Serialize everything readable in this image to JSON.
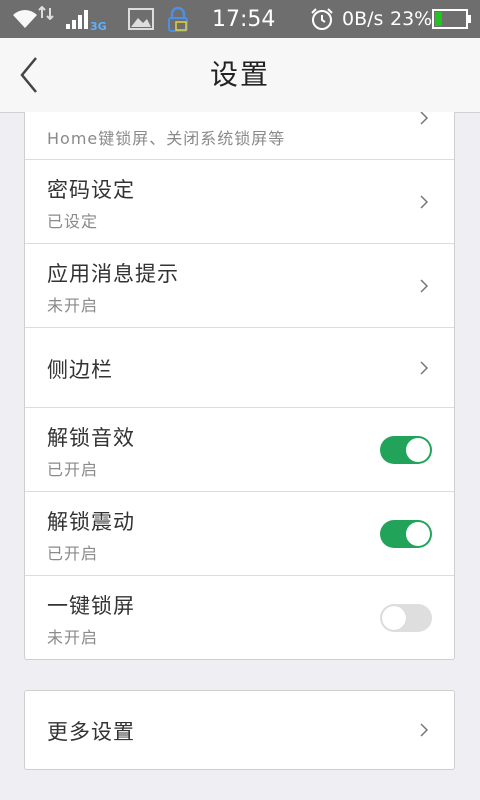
{
  "status_bar": {
    "network_type": "3G",
    "time": "17:54",
    "net_speed": "0B/s",
    "battery_percent": "23%",
    "battery_level": 0.23,
    "battery_color": "#22c322"
  },
  "header": {
    "title": "设置",
    "back_icon": "chevron-left-icon"
  },
  "settings": [
    {
      "title": "",
      "subtitle": "Home键锁屏、关闭系统锁屏等",
      "control": "chevron"
    },
    {
      "title": "密码设定",
      "subtitle": "已设定",
      "control": "chevron"
    },
    {
      "title": "应用消息提示",
      "subtitle": "未开启",
      "control": "chevron"
    },
    {
      "title": "侧边栏",
      "subtitle": "",
      "control": "chevron"
    },
    {
      "title": "解锁音效",
      "subtitle": "已开启",
      "control": "toggle",
      "on": true
    },
    {
      "title": "解锁震动",
      "subtitle": "已开启",
      "control": "toggle",
      "on": true
    },
    {
      "title": "一键锁屏",
      "subtitle": "未开启",
      "control": "toggle",
      "on": false
    }
  ],
  "more": {
    "title": "更多设置"
  },
  "colors": {
    "accent_green": "#22a35a",
    "status_bar_bg": "#6e6e6e",
    "page_bg": "#efeef3"
  }
}
